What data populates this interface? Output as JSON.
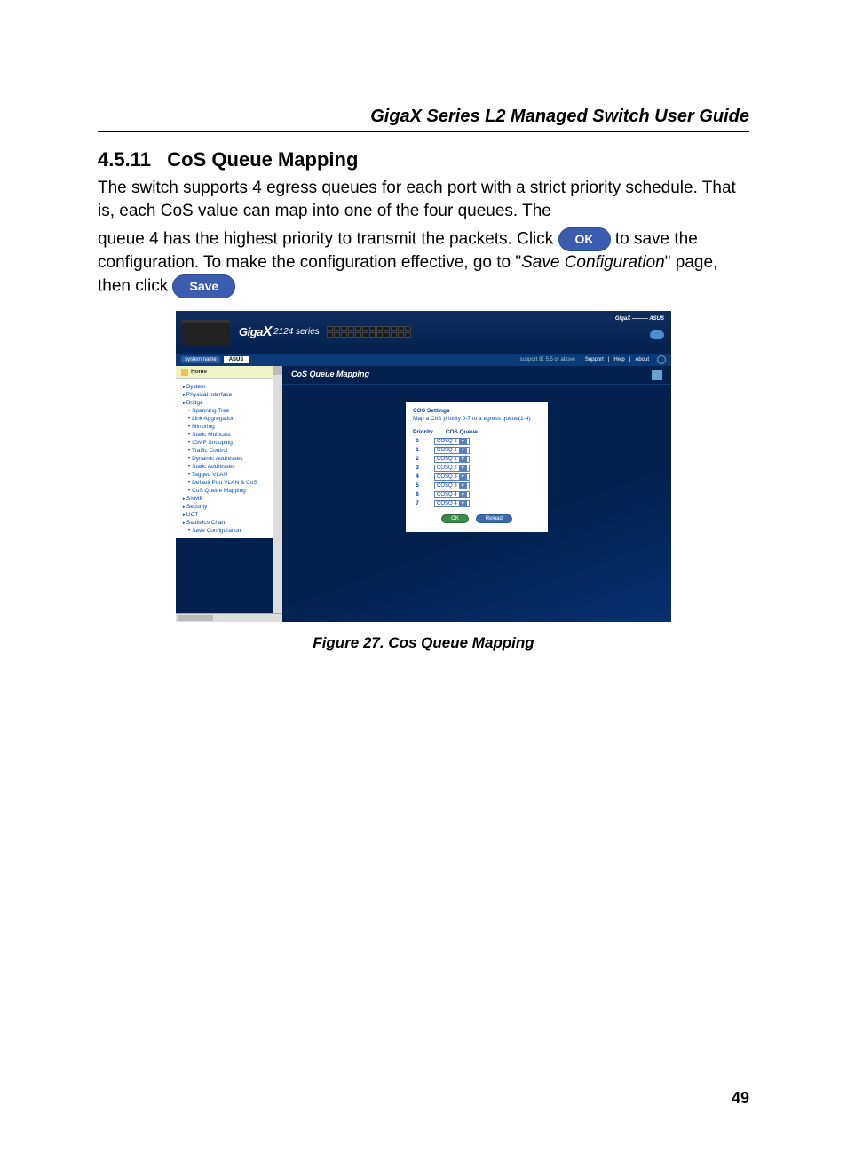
{
  "doc": {
    "header": "GigaX Series L2 Managed Switch User Guide",
    "section_number": "4.5.11",
    "section_title": "CoS Queue Mapping",
    "para1": "The switch supports 4 egress queues for each port with a strict priority schedule. That is, each CoS value can map into one of the four queues. The",
    "para2a": "queue 4 has the highest priority to transmit the packets. Click ",
    "para2b": " to save the configuration. To make the configuration effective, go to \"",
    "para2c": "Save Configuration",
    "para2d": "\" page, then click ",
    "ok_label": "OK",
    "save_label": "Save",
    "figure_caption": "Figure 27.  Cos Queue Mapping",
    "page_number": "49"
  },
  "shot": {
    "logo_a": "Giga",
    "logo_b": "X",
    "series": "2124 series",
    "asus_brand": "GigaX ——— ASUS",
    "sysname_label": "system name",
    "sysname_value": "ASUS",
    "support_text": "support IE 5.5 or above",
    "toplinks": [
      "Support",
      "Help",
      "About"
    ],
    "home_label": "Home",
    "nav": [
      {
        "label": "System",
        "cls": "top"
      },
      {
        "label": "Physical Interface",
        "cls": "top"
      },
      {
        "label": "Bridge",
        "cls": "top"
      },
      {
        "label": "Spanning Tree",
        "cls": "sub"
      },
      {
        "label": "Link Aggregation",
        "cls": "sub"
      },
      {
        "label": "Mirroring",
        "cls": "sub"
      },
      {
        "label": "Static Multicast",
        "cls": "sub"
      },
      {
        "label": "IGMP Snooping",
        "cls": "sub"
      },
      {
        "label": "Traffic Control",
        "cls": "sub"
      },
      {
        "label": "Dynamic Addresses",
        "cls": "sub"
      },
      {
        "label": "Static Addresses",
        "cls": "sub"
      },
      {
        "label": "Tagged VLAN",
        "cls": "sub"
      },
      {
        "label": "Default Port VLAN & CoS",
        "cls": "sub"
      },
      {
        "label": "CoS Queue Mapping",
        "cls": "sub"
      },
      {
        "label": "SNMP",
        "cls": "top"
      },
      {
        "label": "Security",
        "cls": "top"
      },
      {
        "label": "UCT",
        "cls": "top"
      },
      {
        "label": "Statistics Chart",
        "cls": "top"
      },
      {
        "label": "Save Configuration",
        "cls": "sub"
      }
    ],
    "page_title": "CoS Queue Mapping",
    "panel": {
      "heading": "COS Settings",
      "sub": "Map a CoS priority 0-7 to a egress queue(1-4)",
      "col1": "Priority",
      "col2": "COS Queue",
      "rows": [
        {
          "priority": "0",
          "queue": "COSQ 2"
        },
        {
          "priority": "1",
          "queue": "COSQ 1"
        },
        {
          "priority": "2",
          "queue": "COSQ 1"
        },
        {
          "priority": "3",
          "queue": "COSQ 2"
        },
        {
          "priority": "4",
          "queue": "COSQ 3"
        },
        {
          "priority": "5",
          "queue": "COSQ 3"
        },
        {
          "priority": "6",
          "queue": "COSQ 4"
        },
        {
          "priority": "7",
          "queue": "COSQ 4"
        }
      ],
      "ok": "OK",
      "reload": "Reload"
    }
  }
}
